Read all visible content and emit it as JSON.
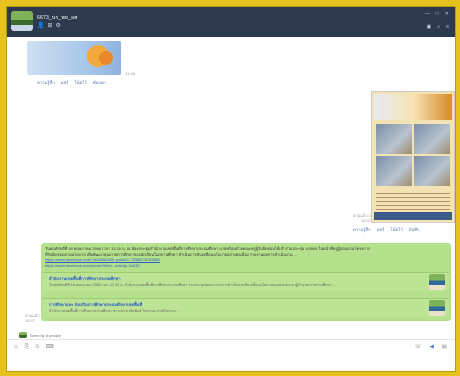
{
  "window": {
    "chat_name": "6673_นร_พย_อศ",
    "meta_icons": [
      "person-icon",
      "grid-icon",
      "settings-icon"
    ],
    "controls": [
      "—",
      "□",
      "✕"
    ],
    "tools": [
      "▣",
      "⌕",
      "≡"
    ]
  },
  "messages": {
    "sticker": {
      "time": "13:38"
    },
    "sticker_actions": [
      "ความรู้สึก",
      "แชร์",
      "โน้ตไว้",
      "คัดลอก"
    ],
    "poster": {
      "time_line1": "อ่านแล้ว 2",
      "time_line2": "15:37"
    },
    "poster_actions": [
      "ความรู้สึก",
      "แชร์",
      "โน้ตไว้",
      "บันทึก"
    ],
    "text_lines": [
      "วันพฤหัสบดีที่ 18 พฤษภาคม 2566 เวลา 13.30 น. ณ ห้องประชุมสำนักงานเขตพื้นที่การศึกษาประถมศึกษา นายพร้อมด้วยคณะครูผู้รับผิดชอบได้เข้าร่วมประชุม 10/999 ในหน้าที่ครูผู้สอนตามโครงการ",
      "ที่รับผิดชอบตามนโยบาย เพื่อพัฒนาคุณภาพการศึกษาของนักเรียนในสถานศึกษา ดำเนินการขับเคลื่อนนโยบายอย่างต่อเนื่อง รายงานผลการดำเนินงาน ..."
    ],
    "links": [
      "https://www.facebook.com/?/s/6596/485..posts/0..799887/3700880",
      "https://www.facebook.com/photo/?fbid=..activity..34430"
    ],
    "cards": [
      {
        "title": "สำนักงานเขตพื้นที่การศึกษาประถมศึกษา",
        "desc": "วันพฤหัสบดีที่ 18 พฤษภาคม 2566 เวลา 13.30 น. สำนักงานเขตพื้นที่การศึกษาประถมศึกษา ร่วมประชุมคณะกรรมการดำเนินงานขับเคลื่อนนโยบายของหน่วยงาน ผู้อำนวยการสถานศึกษา ..."
      },
      {
        "title": "การศึกษาและ ส่งเสริมการศึกษาประถมศึกษาเขตพื้นที่",
        "desc": "สำนักงานเขตพื้นที่การศึกษาประถมศึกษา ข่าวประชาสัมพันธ์ กิจกรรม ภาพกิจกรรม ..."
      }
    ],
    "msg_time_line1": "อ่านแล้ว",
    "msg_time_line2": "15:37",
    "seen_by": "Seen by 8 people"
  },
  "input": {
    "left_icons": [
      "☺",
      "⎘",
      "⊙",
      "⌨"
    ],
    "right_icons": [
      "☏",
      "◀",
      "▤"
    ]
  }
}
